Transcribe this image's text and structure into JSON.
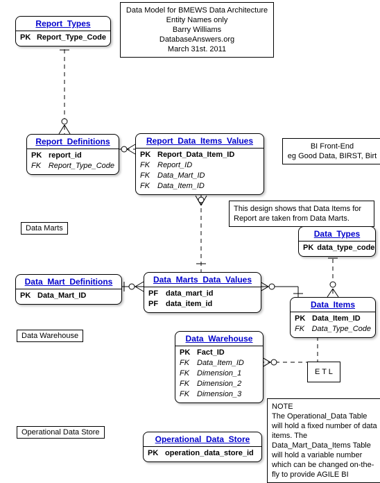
{
  "header": {
    "line1": "Data Model for BMEWS Data Architecture",
    "line2": "Entity Names only",
    "line3": "Barry Williams",
    "line4": "DatabaseAnswers.org",
    "line5": "March 31st. 2011"
  },
  "labels": {
    "data_marts": "Data Marts",
    "data_warehouse": "Data Warehouse",
    "operational_data_store": "Operational Data Store",
    "etl": "E T L"
  },
  "notes": {
    "bi_frontend_l1": "BI Front-End",
    "bi_frontend_l2": "eg Good Data, BIRST, Birt",
    "design_note": "This design shows that Data Items for Report are taken from Data Marts.",
    "bottom_title": "NOTE",
    "bottom_body": "The Operational_Data Table will hold a fixed number of data items. The Data_Mart_Data_Items Table will hold a variable number which can be changed on-the-fly to provide AGILE BI"
  },
  "entities": {
    "report_types": {
      "title": "Report_Types",
      "pk": "PK",
      "pk_name": "Report_Type_Code"
    },
    "report_definitions": {
      "title": "Report_Definitions",
      "pk": "PK",
      "pk_name": "report_id",
      "fk": "FK",
      "fk_name": "Report_Type_Code"
    },
    "report_data_items_values": {
      "title": "Report_Data_Items_Values",
      "pk": "PK",
      "pk_name": "Report_Data_Item_ID",
      "fk1": "FK",
      "fk1_name": "Report_ID",
      "fk2": "FK",
      "fk2_name": "Data_Mart_ID",
      "fk3": "FK",
      "fk3_name": "Data_Item_ID"
    },
    "data_types": {
      "title": "Data_Types",
      "pk": "PK",
      "pk_name": "data_type_code"
    },
    "data_mart_definitions": {
      "title": "Data_Mart_Definitions",
      "pk": "PK",
      "pk_name": "Data_Mart_ID"
    },
    "data_marts_data_values": {
      "title": "Data_Marts_Data_Values",
      "pf1": "PF",
      "pf1_name": "data_mart_id",
      "pf2": "PF",
      "pf2_name": "data_item_id"
    },
    "data_items": {
      "title": "Data_Items",
      "pk": "PK",
      "pk_name": "Data_Item_ID",
      "fk": "FK",
      "fk_name": "Data_Type_Code"
    },
    "data_warehouse": {
      "title": "Data_Warehouse",
      "pk": "PK",
      "pk_name": "Fact_ID",
      "fk1": "FK",
      "fk1_name": "Data_Item_ID",
      "fk2": "FK",
      "fk2_name": "Dimension_1",
      "fk3": "FK",
      "fk3_name": "Dimension_2",
      "fk4": "FK",
      "fk4_name": "Dimension_3"
    },
    "operational_data_store": {
      "title": "Operational_Data_Store",
      "pk": "PK",
      "pk_name": "operation_data_store_id"
    }
  }
}
